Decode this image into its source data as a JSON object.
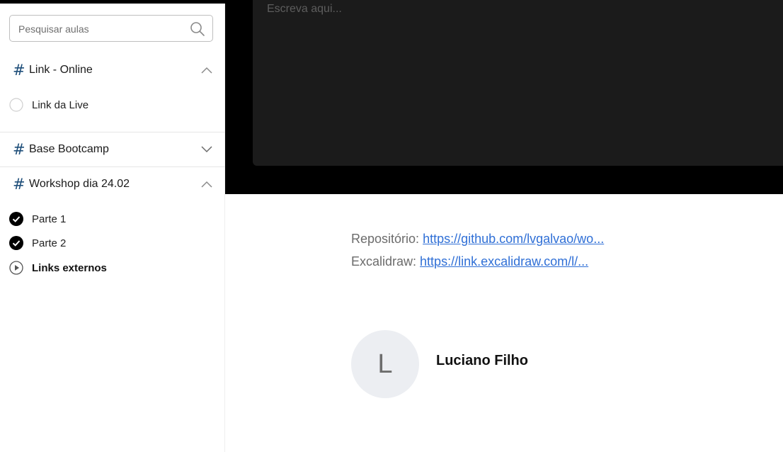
{
  "sidebar": {
    "search": {
      "placeholder": "Pesquisar aulas",
      "icon": "search-icon"
    },
    "sections": [
      {
        "hash": "#",
        "title": "Link - Online",
        "expanded": true,
        "lessons": [
          {
            "label": "Link da Live",
            "status": "not-started"
          }
        ]
      },
      {
        "hash": "#",
        "title": "Base Bootcamp",
        "expanded": false,
        "lessons": []
      },
      {
        "hash": "#",
        "title": "Workshop dia 24.02",
        "expanded": true,
        "lessons": [
          {
            "label": "Parte 1",
            "status": "completed"
          },
          {
            "label": "Parte 2",
            "status": "completed"
          },
          {
            "label": "Links externos",
            "status": "current"
          }
        ]
      }
    ]
  },
  "notes": {
    "placeholder": "Escreva aqui..."
  },
  "content": {
    "links": [
      {
        "label": "Repositório:",
        "url_text": "https://github.com/lvgalvao/wo..."
      },
      {
        "label": "Excalidraw:",
        "url_text": "https://link.excalidraw.com/l/..."
      }
    ]
  },
  "author": {
    "initial": "L",
    "name": "Luciano Filho"
  },
  "colors": {
    "link": "#2f6fd6",
    "section_hash": "#1f4f7a",
    "video_bg": "#000000",
    "notes_bg": "#1b1b1b"
  }
}
